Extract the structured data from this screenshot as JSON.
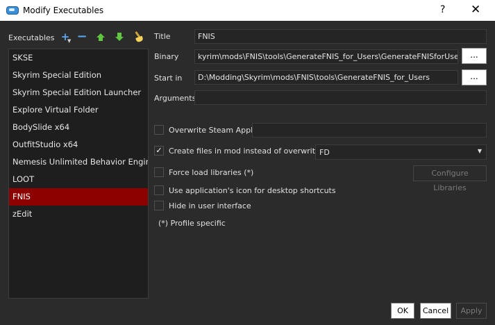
{
  "window": {
    "title": "Modify Executables",
    "help": "?",
    "close": "✕"
  },
  "toolbar": {
    "label": "Executables"
  },
  "executables": [
    {
      "label": "SKSE"
    },
    {
      "label": "Skyrim Special Edition"
    },
    {
      "label": "Skyrim Special Edition Launcher"
    },
    {
      "label": "Explore Virtual Folder"
    },
    {
      "label": "BodySlide x64"
    },
    {
      "label": "OutfitStudio x64"
    },
    {
      "label": "Nemesis Unlimited Behavior Engine"
    },
    {
      "label": "LOOT"
    },
    {
      "label": "FNIS",
      "selected": true
    },
    {
      "label": "zEdit"
    }
  ],
  "form": {
    "title_label": "Title",
    "title_value": "FNIS",
    "binary_label": "Binary",
    "binary_value": "kyrim\\mods\\FNIS\\tools\\GenerateFNIS_for_Users\\GenerateFNISforUsers.exe",
    "startin_label": "Start in",
    "startin_value": "D:\\Modding\\Skyrim\\mods\\FNIS\\tools\\GenerateFNIS_for_Users",
    "arguments_label": "Arguments",
    "arguments_value": "",
    "browse_label": "..."
  },
  "options": {
    "steam_appid": {
      "label": "Overwrite Steam AppID",
      "checked": false,
      "value": ""
    },
    "create_in_mod": {
      "label": "Create files in mod instead of overwrite (*)",
      "checked": true,
      "value": "FD"
    },
    "force_load": {
      "label": "Force load libraries (*)",
      "checked": false
    },
    "configure_libraries": "Configure Libraries",
    "use_icon": {
      "label": "Use application's icon for desktop shortcuts",
      "checked": false
    },
    "hide": {
      "label": "Hide in user interface",
      "checked": false
    },
    "profile_note": "(*) Profile specific"
  },
  "buttons": {
    "ok": "OK",
    "cancel": "Cancel",
    "apply": "Apply"
  }
}
